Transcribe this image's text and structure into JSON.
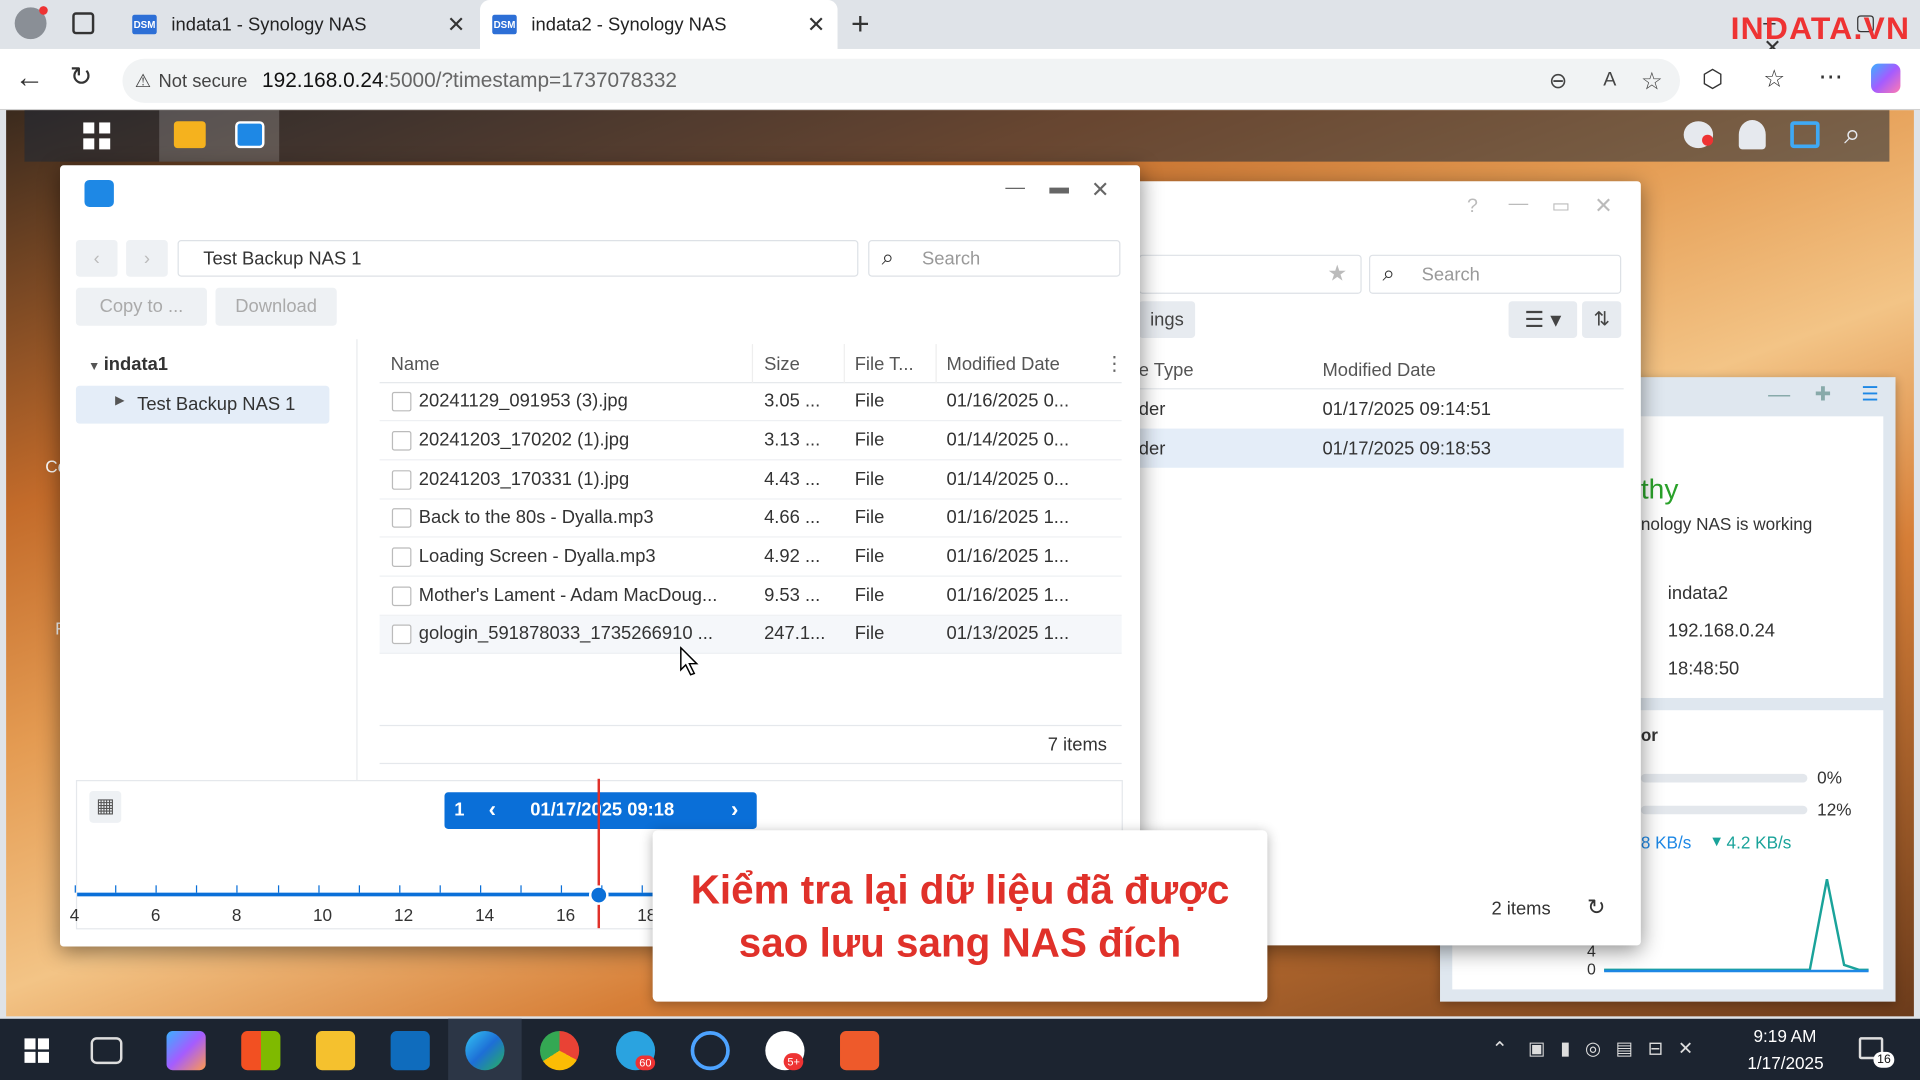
{
  "browser": {
    "tabs": [
      {
        "title": "indata1 - Synology NAS",
        "favicon": "DSM"
      },
      {
        "title": "indata2 - Synology NAS",
        "favicon": "DSM"
      }
    ],
    "security": "Not secure",
    "url_host": "192.168.0.24",
    "url_rest": ":5000/?timestamp=1737078332",
    "brand": "INDATA.VN"
  },
  "snapshot_window": {
    "path": "Test Backup NAS 1",
    "search_placeholder": "Search",
    "copy_label": "Copy to ...",
    "download_label": "Download",
    "tree": {
      "root": "indata1",
      "child": "Test Backup NAS 1"
    },
    "columns": [
      "Name",
      "Size",
      "File T...",
      "Modified Date"
    ],
    "files": [
      {
        "name": "20241129_091953 (3).jpg",
        "size": "3.05 ...",
        "type": "File",
        "date": "01/16/2025 0..."
      },
      {
        "name": "20241203_170202 (1).jpg",
        "size": "3.13 ...",
        "type": "File",
        "date": "01/14/2025 0..."
      },
      {
        "name": "20241203_170331 (1).jpg",
        "size": "4.43 ...",
        "type": "File",
        "date": "01/14/2025 0..."
      },
      {
        "name": "Back to the 80s - Dyalla.mp3",
        "size": "4.66 ...",
        "type": "File",
        "date": "01/16/2025 1..."
      },
      {
        "name": "Loading Screen - Dyalla.mp3",
        "size": "4.92 ...",
        "type": "File",
        "date": "01/16/2025 1..."
      },
      {
        "name": "Mother's Lament - Adam MacDoug...",
        "size": "9.53 ...",
        "type": "File",
        "date": "01/16/2025 1..."
      },
      {
        "name": "gologin_591878033_1735266910 ...",
        "size": "247.1...",
        "type": "File",
        "date": "01/13/2025 1..."
      }
    ],
    "item_count": "7 items",
    "timeline": {
      "count": "1",
      "datetime": "01/17/2025 09:18",
      "ticks": [
        "4",
        "6",
        "8",
        "10",
        "12",
        "14",
        "16",
        "18"
      ]
    }
  },
  "file_station": {
    "search_placeholder": "Search",
    "settings_partial": "ings",
    "col_type": "e Type",
    "col_modified": "Modified Date",
    "rows": [
      {
        "type": "der",
        "date": "01/17/2025 09:14:51"
      },
      {
        "type": "der",
        "date": "01/17/2025 09:18:53"
      }
    ],
    "item_count": "2 items"
  },
  "widget": {
    "status": "thy",
    "status_desc": "nology NAS is working",
    "server_name": "indata2",
    "ip": "192.168.0.24",
    "uptime": "18:48:50",
    "monitor_title": "or",
    "cpu": "0%",
    "ram": "12%",
    "upload": "8 KB/s",
    "download": "4.2 KB/s",
    "chart_tick_4": "4",
    "chart_tick_0": "0"
  },
  "desktop_frag": {
    "c": "Co",
    "f": "F"
  },
  "banner": {
    "line1": "Kiểm tra lại dữ liệu đã được",
    "line2": "sao lưu sang NAS đích"
  },
  "taskbar": {
    "time": "9:19 AM",
    "date": "1/17/2025",
    "telegram_badge": "60",
    "zalo_badge": "5+",
    "notif_count": "16"
  },
  "colors": {
    "accent": "#0a6fd8",
    "banner_text": "#e0312a",
    "healthy_green": "#2aa12a"
  }
}
